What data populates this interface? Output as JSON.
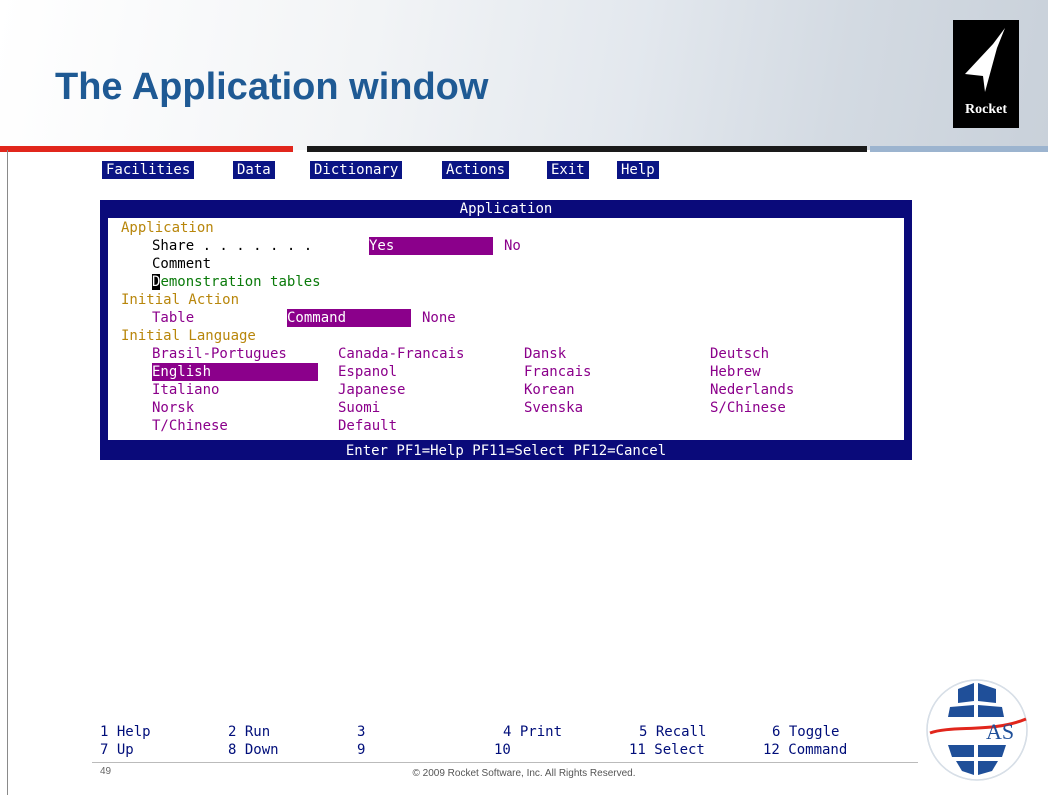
{
  "slide": {
    "title": "The Application window",
    "page_number": "49",
    "copyright": "© 2009 Rocket Software, Inc. All Rights Reserved.",
    "logo_text": "Rocket",
    "badge_text": "AS"
  },
  "menu": [
    "Facilities",
    "Data",
    "Dictionary",
    "Actions",
    "Exit",
    "Help"
  ],
  "dialog": {
    "title": "Application",
    "section_application": "Application",
    "share_label": "Share . . . . . . .",
    "share_yes": "Yes",
    "share_no": "No",
    "comment_label": "Comment",
    "demo_first": "D",
    "demo_rest": "emonstration tables",
    "section_initial_action": "Initial Action",
    "table_label": "Table",
    "action_selected": "Command",
    "action_none": "None",
    "section_initial_language": "Initial Language",
    "languages": [
      [
        "Brasil-Portugues",
        "Canada-Francais",
        "Dansk",
        "Deutsch"
      ],
      [
        "English",
        "Espanol",
        "Francais",
        "Hebrew"
      ],
      [
        "Italiano",
        "Japanese",
        "Korean",
        "Nederlands"
      ],
      [
        "Norsk",
        "Suomi",
        "Svenska",
        "S/Chinese"
      ],
      [
        "T/Chinese",
        "Default",
        "",
        ""
      ]
    ],
    "footer": "Enter PF1=Help PF11=Select PF12=Cancel"
  },
  "pf_keys": {
    "row1": [
      "1 Help",
      "2 Run",
      "3",
      "4 Print",
      "5 Recall",
      "6 Toggle"
    ],
    "row2": [
      "7 Up",
      "8 Down",
      "9",
      "10",
      "11 Select",
      "12 Command"
    ]
  },
  "colors": {
    "title_blue": "#1f5a94",
    "terminal_navy": "#0a1484",
    "selection_purple": "#8b008b",
    "label_gold": "#b8860b",
    "green_text": "#0a7a0a",
    "accent_red": "#e1261c"
  }
}
